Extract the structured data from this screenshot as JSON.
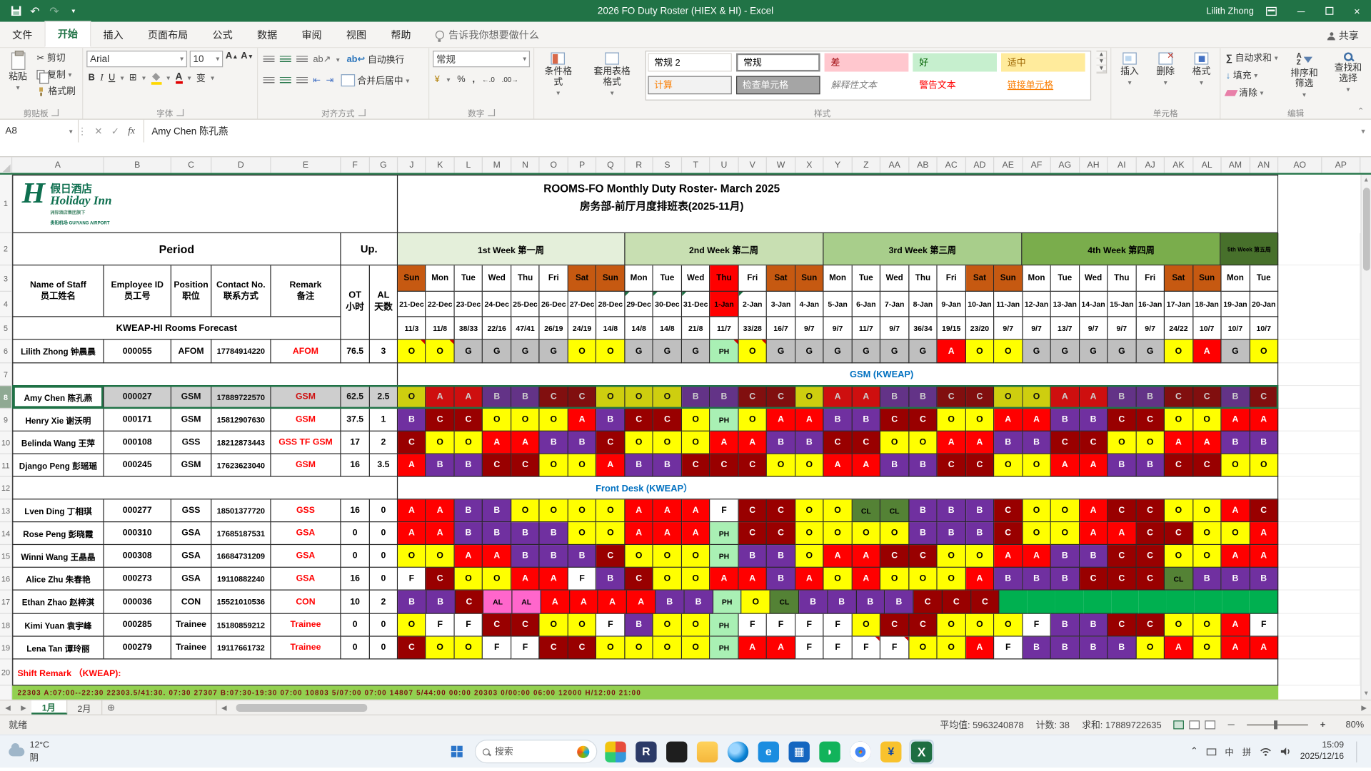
{
  "title_bar": {
    "title": "2026 FO Duty Roster (HIEX & HI)  -  Excel",
    "user": "Lilith Zhong"
  },
  "menu": {
    "tabs": [
      "文件",
      "开始",
      "插入",
      "页面布局",
      "公式",
      "数据",
      "审阅",
      "视图",
      "帮助"
    ],
    "active_tab": "开始",
    "tell_me": "告诉我你想要做什么",
    "share": "共享"
  },
  "ribbon": {
    "clipboard": {
      "label": "剪贴板",
      "paste": "粘贴",
      "cut": "剪切",
      "copy": "复制",
      "painter": "格式刷"
    },
    "font": {
      "label": "字体",
      "family": "Arial",
      "size": "10",
      "pinyin": "变"
    },
    "alignment": {
      "label": "对齐方式",
      "wrap": "自动换行",
      "merge": "合并后居中"
    },
    "number": {
      "label": "数字",
      "format": "常规"
    },
    "styles": {
      "label": "样式",
      "conditional": "条件格式",
      "table_format": "套用表格格式",
      "gallery": [
        {
          "label": "常规 2",
          "bg": "#ffffff",
          "fg": "#000000",
          "border": "#d8d5d0"
        },
        {
          "label": "常规",
          "bg": "#ffffff",
          "fg": "#000000",
          "border": "#8a8a8a"
        },
        {
          "label": "差",
          "bg": "#ffc7ce",
          "fg": "#9c0006",
          "border": "#ffc7ce"
        },
        {
          "label": "好",
          "bg": "#c6efce",
          "fg": "#006100",
          "border": "#c6efce"
        },
        {
          "label": "适中",
          "bg": "#ffeb9c",
          "fg": "#9c6500",
          "border": "#ffeb9c"
        },
        {
          "label": "计算",
          "bg": "#f2f2f2",
          "fg": "#fa7d00",
          "border": "#7f7f7f"
        },
        {
          "label": "检查单元格",
          "bg": "#a5a5a5",
          "fg": "#ffffff",
          "border": "#3f3f3f"
        },
        {
          "label": "解释性文本",
          "bg": "#ffffff",
          "fg": "#7f7f7f",
          "border": "#ffffff",
          "italic": true
        },
        {
          "label": "警告文本",
          "bg": "#ffffff",
          "fg": "#ff0000",
          "border": "#ffffff"
        },
        {
          "label": "链接单元格",
          "bg": "#ffffff",
          "fg": "#fa7d00",
          "border": "#ffffff",
          "underline": true
        }
      ]
    },
    "cells": {
      "label": "单元格",
      "insert": "插入",
      "delete": "删除",
      "format": "格式"
    },
    "editing": {
      "label": "编辑",
      "autosum": "自动求和",
      "fill": "填充",
      "clear": "清除",
      "sort": "排序和筛选",
      "find": "查找和选择"
    }
  },
  "formula_bar": {
    "name_box": "A8",
    "value": "Amy Chen 陈孔燕"
  },
  "sheet": {
    "left_col_letters": [
      "A",
      "B",
      "C",
      "D",
      "E",
      "F",
      "G"
    ],
    "day_col_letters": [
      "J",
      "K",
      "L",
      "M",
      "N",
      "O",
      "P",
      "Q",
      "R",
      "S",
      "T",
      "U",
      "V",
      "W",
      "X",
      "Y",
      "Z",
      "AA",
      "AB",
      "AC",
      "AD",
      "AE",
      "AF",
      "AG",
      "AH",
      "AI",
      "AJ",
      "AK",
      "AL",
      "AM",
      "AN"
    ],
    "right_col_letters": [
      "AO",
      "AP"
    ],
    "logo": {
      "cn": "假日酒店",
      "en": "Holiday Inn",
      "sub": "洲际酒店集团旗下",
      "airport_cn": "贵阳机场",
      "airport_en": "GUIYANG AIRPORT"
    },
    "title1": "ROOMS-FO Monthly Duty Roster- March 2025",
    "title2": "房务部-前厅月度排班表(2025-11月)",
    "period": "Period",
    "up": "Up.",
    "weeks": [
      {
        "label": "1st Week 第一周",
        "span": 8,
        "bg": "#e4efda"
      },
      {
        "label": "2nd Week 第二周",
        "span": 7,
        "bg": "#c8dfb2"
      },
      {
        "label": "3rd Week 第三周",
        "span": 7,
        "bg": "#a8ce8b"
      },
      {
        "label": "4th Week 第四周",
        "span": 7,
        "bg": "#7aad4c"
      },
      {
        "label": "5th Week 第五周",
        "span": 2,
        "bg": "#47702b"
      }
    ],
    "days": [
      "Sun",
      "Mon",
      "Tue",
      "Wed",
      "Thu",
      "Fri",
      "Sat",
      "Sun",
      "Mon",
      "Tue",
      "Wed",
      "Thu",
      "Fri",
      "Sat",
      "Sun",
      "Mon",
      "Tue",
      "Wed",
      "Thu",
      "Fri",
      "Sat",
      "Sun",
      "Mon",
      "Tue",
      "Wed",
      "Thu",
      "Fri",
      "Sat",
      "Sun",
      "Mon",
      "Tue"
    ],
    "weekend_idx": [
      0,
      6,
      7,
      13,
      14,
      20,
      21,
      27,
      28
    ],
    "holiday_idx": [
      11
    ],
    "dates": [
      "21-Dec",
      "22-Dec",
      "23-Dec",
      "24-Dec",
      "25-Dec",
      "26-Dec",
      "27-Dec",
      "28-Dec",
      "29-Dec",
      "30-Dec",
      "31-Dec",
      "1-Jan",
      "2-Jan",
      "3-Jan",
      "4-Jan",
      "5-Jan",
      "6-Jan",
      "7-Jan",
      "8-Jan",
      "9-Jan",
      "10-Jan",
      "11-Jan",
      "12-Jan",
      "13-Jan",
      "14-Jan",
      "15-Jan",
      "16-Jan",
      "17-Jan",
      "18-Jan",
      "19-Jan",
      "20-Jan"
    ],
    "date_green_marks": [
      8,
      9,
      10,
      12
    ],
    "headers": {
      "name": "Name of Staff",
      "name_cn": "员工姓名",
      "id": "Employee ID",
      "id_cn": "员工号",
      "pos": "Position",
      "pos_cn": "职位",
      "contact": "Contact No.",
      "contact_cn": "联系方式",
      "remark": "Remark",
      "remark_cn": "备注",
      "ot": "OT",
      "ot_cn": "小时",
      "al": "AL",
      "al_cn": "天数"
    },
    "forecast_label": "KWEAP-HI Rooms Forecast",
    "forecast": [
      "11/3",
      "11/8",
      "38/33",
      "22/16",
      "47/41",
      "26/19",
      "24/19",
      "14/8",
      "14/8",
      "14/8",
      "21/8",
      "11/7",
      "33/28",
      "16/7",
      "9/7",
      "9/7",
      "11/7",
      "9/7",
      "36/34",
      "19/15",
      "23/20",
      "9/7",
      "9/7",
      "13/7",
      "9/7",
      "9/7",
      "9/7",
      "24/22",
      "10/7",
      "10/7",
      "10/7"
    ],
    "shift_colors": {
      "O": [
        "#ffff00",
        "#000000"
      ],
      "A": [
        "#ff0000",
        "#ffffff"
      ],
      "B": [
        "#7030a0",
        "#ffffff"
      ],
      "C": [
        "#990000",
        "#ffffff"
      ],
      "G": [
        "#bfbfbf",
        "#000000"
      ],
      "PH": [
        "#a9f0b4",
        "#000000"
      ],
      "F": [
        "#ffffff",
        "#000000"
      ],
      "CL": [
        "#548235",
        "#000000"
      ],
      "AL": [
        "#ff66cc",
        "#000000"
      ],
      "~": [
        "#00b050",
        "#00b050"
      ]
    },
    "rows": [
      {
        "n": 6,
        "type": "staff",
        "name": "Lilith Zhong 钟晨晨",
        "id": "000055",
        "pos": "AFOM",
        "phone": "17784914220",
        "remark": "AFOM",
        "ot": "76.5",
        "al": "3",
        "red_marks": [
          0,
          1,
          11,
          12
        ],
        "shifts": [
          "O",
          "O",
          "G",
          "G",
          "G",
          "G",
          "O",
          "O",
          "G",
          "G",
          "G",
          "PH",
          "O",
          "G",
          "G",
          "G",
          "G",
          "G",
          "G",
          "A",
          "O",
          "O",
          "G",
          "G",
          "G",
          "G",
          "G",
          "O",
          "A",
          "G",
          "O"
        ]
      },
      {
        "n": 7,
        "type": "section",
        "label": "GSM (KWEAP)",
        "label_pos": 55
      },
      {
        "n": 8,
        "type": "staff",
        "selected": true,
        "name": "Amy Chen 陈孔燕",
        "id": "000027",
        "pos": "GSM",
        "phone": "17889722570",
        "remark": "GSM",
        "ot": "62.5",
        "al": "2.5",
        "red_marks": [],
        "shifts": [
          "O",
          "A",
          "A",
          "B",
          "B",
          "C",
          "C",
          "O",
          "O",
          "O",
          "B",
          "B",
          "C",
          "C",
          "O",
          "A",
          "A",
          "B",
          "B",
          "C",
          "C",
          "O",
          "O",
          "A",
          "A",
          "B",
          "B",
          "C",
          "C",
          "B",
          "C"
        ]
      },
      {
        "n": 9,
        "type": "staff",
        "name": "Henry Xie 谢沃明",
        "id": "000171",
        "pos": "GSM",
        "phone": "15812907630",
        "remark": "GSM",
        "ot": "37.5",
        "al": "1",
        "red_marks": [],
        "shifts": [
          "B",
          "C",
          "C",
          "O",
          "O",
          "O",
          "A",
          "B",
          "C",
          "C",
          "O",
          "PH",
          "O",
          "A",
          "A",
          "B",
          "B",
          "C",
          "C",
          "O",
          "O",
          "A",
          "A",
          "B",
          "B",
          "C",
          "C",
          "O",
          "O",
          "A",
          "A"
        ]
      },
      {
        "n": 10,
        "type": "staff",
        "name": "Belinda Wang 王萍",
        "id": "000108",
        "pos": "GSS",
        "phone": "18212873443",
        "remark": "GSS TF GSM",
        "ot": "17",
        "al": "2",
        "red_marks": [],
        "shifts": [
          "C",
          "O",
          "O",
          "A",
          "A",
          "B",
          "B",
          "C",
          "O",
          "O",
          "O",
          "A",
          "A",
          "B",
          "B",
          "C",
          "C",
          "O",
          "O",
          "A",
          "A",
          "B",
          "B",
          "C",
          "C",
          "O",
          "O",
          "A",
          "A",
          "B",
          "B"
        ]
      },
      {
        "n": 11,
        "type": "staff",
        "name": "Django Peng 彭瑶瑶",
        "id": "000245",
        "pos": "GSM",
        "phone": "17623623040",
        "remark": "GSM",
        "ot": "16",
        "al": "3.5",
        "red_marks": [],
        "shifts": [
          "A",
          "B",
          "B",
          "C",
          "C",
          "O",
          "O",
          "A",
          "B",
          "B",
          "C",
          "C",
          "C",
          "O",
          "O",
          "A",
          "A",
          "B",
          "B",
          "C",
          "C",
          "O",
          "O",
          "A",
          "A",
          "B",
          "B",
          "C",
          "C",
          "O",
          "O"
        ]
      },
      {
        "n": 12,
        "type": "section",
        "label": "Front Desk (KWEAP）",
        "label_pos": 28
      },
      {
        "n": 13,
        "type": "staff",
        "name": "Lven Ding 丁相琪",
        "id": "000277",
        "pos": "GSS",
        "phone": "18501377720",
        "remark": "GSS",
        "ot": "16",
        "al": "0",
        "red_marks": [],
        "shifts": [
          "A",
          "A",
          "B",
          "B",
          "O",
          "O",
          "O",
          "O",
          "A",
          "A",
          "A",
          "F",
          "C",
          "C",
          "O",
          "O",
          "CL",
          "CL",
          "B",
          "B",
          "B",
          "C",
          "O",
          "O",
          "A",
          "C",
          "C",
          "O",
          "O",
          "A",
          "C"
        ]
      },
      {
        "n": 14,
        "type": "staff",
        "name": "Rose Peng 彭晓霞",
        "id": "000310",
        "pos": "GSA",
        "phone": "17685187531",
        "remark": "GSA",
        "ot": "0",
        "al": "0",
        "red_marks": [],
        "shifts": [
          "A",
          "A",
          "B",
          "B",
          "B",
          "B",
          "O",
          "O",
          "A",
          "A",
          "A",
          "PH",
          "C",
          "C",
          "O",
          "O",
          "O",
          "O",
          "B",
          "B",
          "B",
          "C",
          "O",
          "O",
          "A",
          "A",
          "C",
          "C",
          "O",
          "O",
          "A"
        ]
      },
      {
        "n": 15,
        "type": "staff",
        "name": "Winni Wang 王晶晶",
        "id": "000308",
        "pos": "GSA",
        "phone": "16684731209",
        "remark": "GSA",
        "ot": "0",
        "al": "0",
        "red_marks": [],
        "shifts": [
          "O",
          "O",
          "A",
          "A",
          "B",
          "B",
          "B",
          "C",
          "O",
          "O",
          "O",
          "PH",
          "B",
          "B",
          "O",
          "A",
          "A",
          "C",
          "C",
          "O",
          "O",
          "A",
          "A",
          "B",
          "B",
          "C",
          "C",
          "O",
          "O",
          "A",
          "A"
        ]
      },
      {
        "n": 16,
        "type": "staff",
        "name": "Alice Zhu 朱春艳",
        "id": "000273",
        "pos": "GSA",
        "phone": "19110882240",
        "remark": "GSA",
        "ot": "16",
        "al": "0",
        "red_marks": [],
        "shifts": [
          "F",
          "C",
          "O",
          "O",
          "A",
          "A",
          "F",
          "B",
          "C",
          "O",
          "O",
          "A",
          "A",
          "B",
          "A",
          "O",
          "A",
          "O",
          "O",
          "O",
          "A",
          "B",
          "B",
          "B",
          "C",
          "C",
          "C",
          "CL",
          "B",
          "B",
          "B"
        ]
      },
      {
        "n": 17,
        "type": "staff",
        "name": "Ethan Zhao 赵梓淇",
        "id": "000036",
        "pos": "CON",
        "phone": "15521010536",
        "remark": "CON",
        "ot": "10",
        "al": "2",
        "red_marks": [],
        "shifts": [
          "B",
          "B",
          "C",
          "AL",
          "AL",
          "A",
          "A",
          "A",
          "A",
          "B",
          "B",
          "PH",
          "O",
          "CL",
          "B",
          "B",
          "B",
          "B",
          "C",
          "C",
          "C",
          "~",
          "~",
          "~",
          "~",
          "~",
          "~",
          "~",
          "~",
          "~",
          "~"
        ]
      },
      {
        "n": 18,
        "type": "staff",
        "name": "Kimi Yuan 袁宇峰",
        "id": "000285",
        "pos": "Trainee",
        "phone": "15180859212",
        "remark": "Trainee",
        "ot": "0",
        "al": "0",
        "red_marks": [],
        "shifts": [
          "O",
          "F",
          "F",
          "C",
          "C",
          "O",
          "O",
          "F",
          "B",
          "O",
          "O",
          "PH",
          "F",
          "F",
          "F",
          "F",
          "O",
          "C",
          "C",
          "O",
          "O",
          "O",
          "F",
          "B",
          "B",
          "C",
          "C",
          "O",
          "O",
          "A",
          "F"
        ]
      },
      {
        "n": 19,
        "type": "staff",
        "name": "Lena Tan 谭玲丽",
        "id": "000279",
        "pos": "Trainee",
        "phone": "19117661732",
        "remark": "Trainee",
        "ot": "0",
        "al": "0",
        "red_marks": [
          16,
          17
        ],
        "shifts": [
          "C",
          "O",
          "O",
          "F",
          "F",
          "C",
          "C",
          "O",
          "O",
          "O",
          "O",
          "PH",
          "A",
          "A",
          "F",
          "F",
          "F",
          "F",
          "O",
          "O",
          "A",
          "F",
          "B",
          "B",
          "B",
          "B",
          "O",
          "A",
          "O",
          "A",
          "A"
        ]
      },
      {
        "n": 20,
        "type": "remark",
        "label": "Shift Remark （KWEAP):"
      }
    ],
    "legend_strip": "22303 A:07:00--22:30    22303.5/41:30.    07:30    27307 B:07:30-19:30    07:00    10803 5/07:00    07:00    14807 5/44:00    00:00    20303 0/00:00    06:00    12000 H/12:00    21:00"
  },
  "sheet_tabs": {
    "tabs": [
      "1月",
      "2月"
    ],
    "active": "1月"
  },
  "status_bar": {
    "ready": "就绪",
    "average": "平均值: 5963240878",
    "count": "计数: 38",
    "sum": "求和: 17889722635",
    "zoom": "80%"
  },
  "taskbar": {
    "weather_temp": "12°C",
    "weather_cond": "阴",
    "search": "搜索",
    "icons": [
      "people",
      "contact",
      "console",
      "folder",
      "edge",
      "ie",
      "store",
      "wechat",
      "chrome",
      "finance",
      "excel"
    ],
    "active_icon": "excel",
    "ime1": "中",
    "ime2": "拼",
    "time": "15:09",
    "date": "2025/12/16"
  }
}
